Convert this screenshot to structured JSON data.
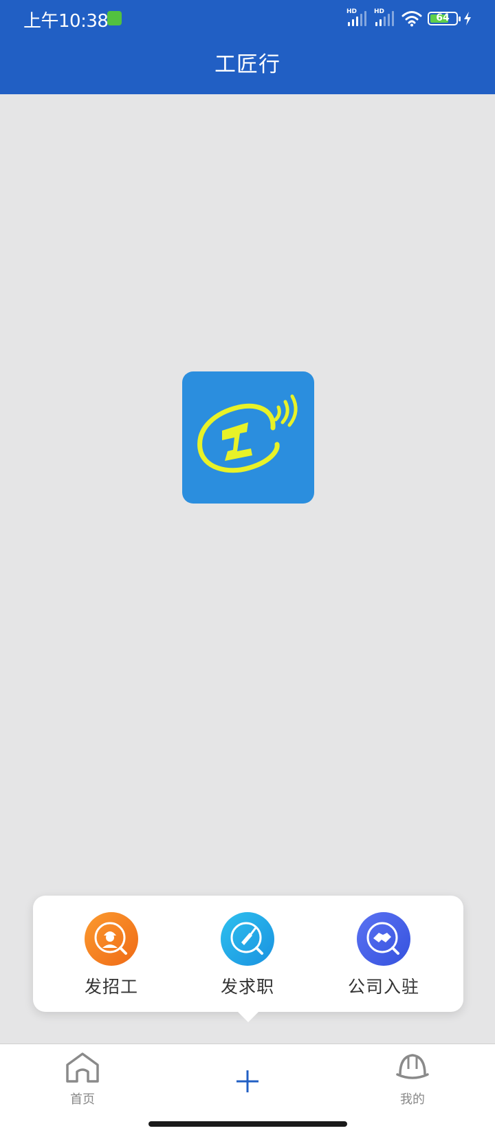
{
  "status_bar": {
    "time": "上午10:38",
    "battery": "64",
    "network_labels": [
      "HD",
      "HD"
    ]
  },
  "header": {
    "title": "工匠行",
    "color": "#215fc4"
  },
  "logo": {
    "icon": "app-logo-icon",
    "background": "#2b8ede",
    "accent": "#e8f228"
  },
  "popup": {
    "actions": [
      {
        "label": "发招工",
        "icon": "worker-search-icon",
        "color": "#f27a1e"
      },
      {
        "label": "发求职",
        "icon": "trowel-search-icon",
        "color": "#1ea6e8"
      },
      {
        "label": "公司入驻",
        "icon": "handshake-search-icon",
        "color": "#4160e8"
      }
    ]
  },
  "tabbar": {
    "items": [
      {
        "label": "首页",
        "icon": "home-icon"
      },
      {
        "label": "",
        "icon": "plus-icon"
      },
      {
        "label": "我的",
        "icon": "helmet-icon"
      }
    ]
  }
}
